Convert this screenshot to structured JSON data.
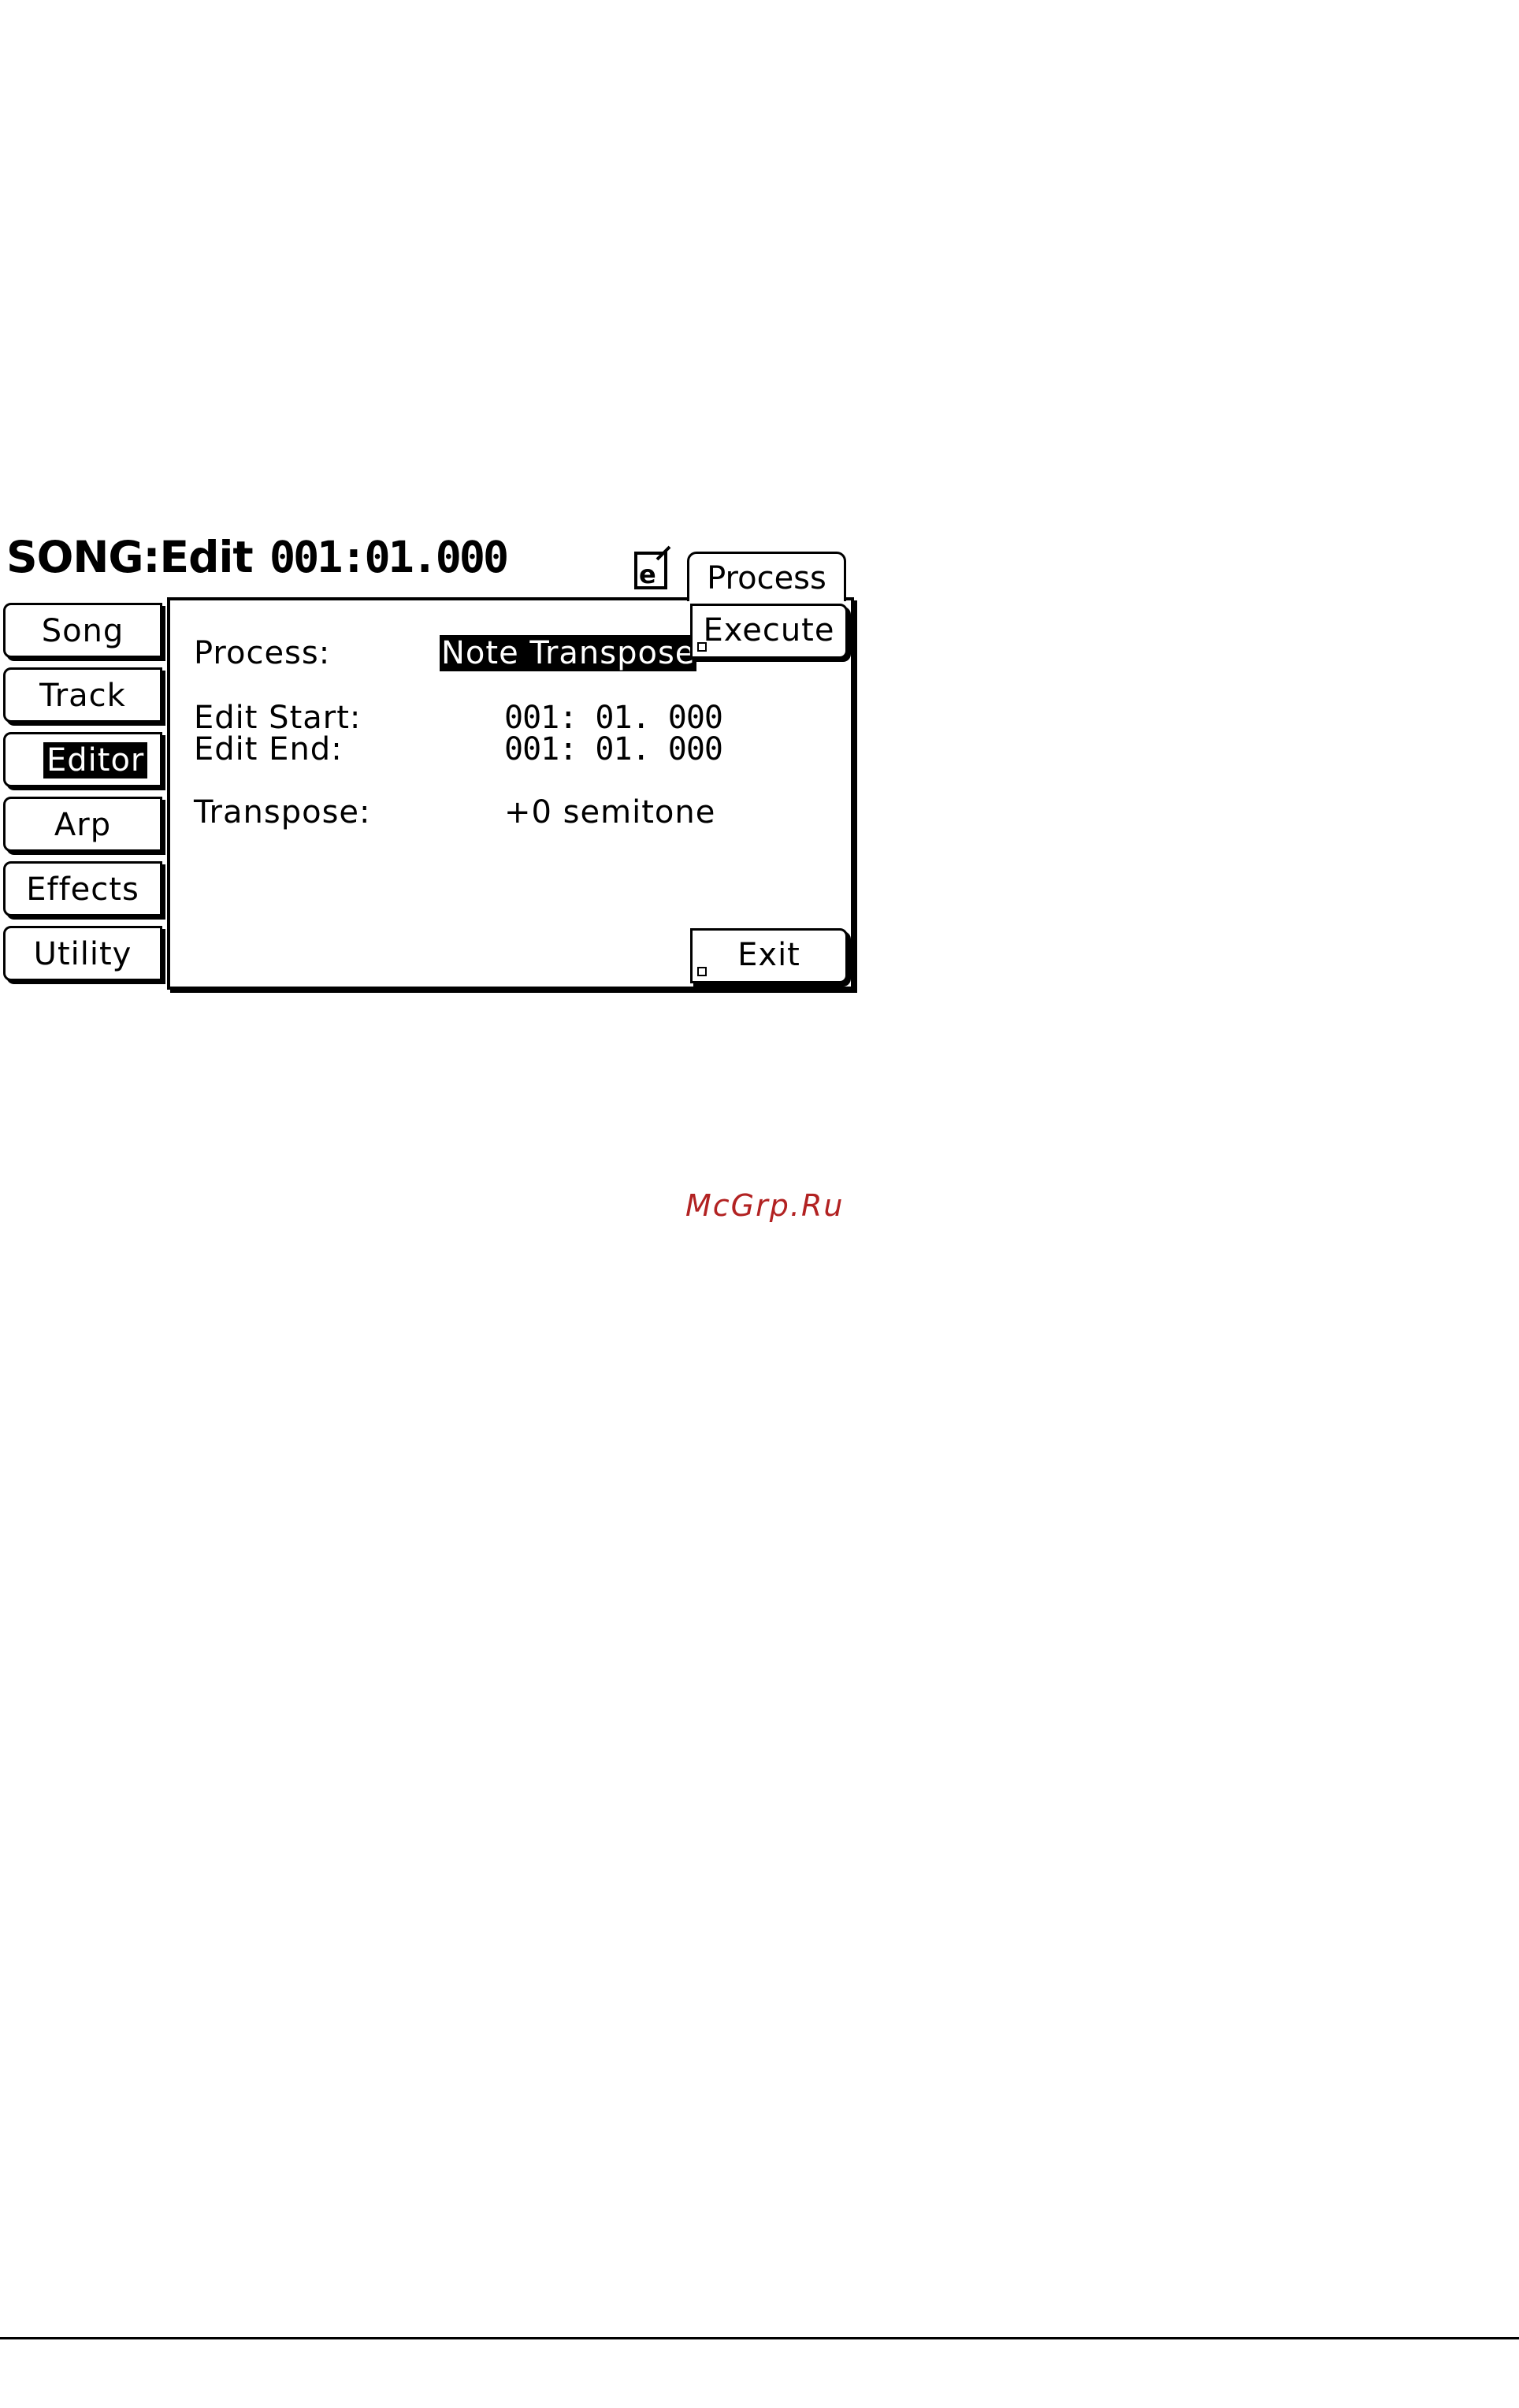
{
  "header": {
    "title": "SONG:Edit",
    "position": "001:01.000",
    "tab": "Process"
  },
  "sidebar": {
    "items": [
      {
        "label": "Song",
        "active": false
      },
      {
        "label": "Track",
        "active": false
      },
      {
        "label": "Editor",
        "active": true
      },
      {
        "label": "Arp",
        "active": false
      },
      {
        "label": "Effects",
        "active": false
      },
      {
        "label": "Utility",
        "active": false
      }
    ]
  },
  "panel": {
    "process_label": "Process:",
    "process_value": "Note Transpose",
    "edit_start_label": "Edit Start:",
    "edit_start_value": "001: 01. 000",
    "edit_end_label": "Edit End:",
    "edit_end_value": "001: 01. 000",
    "transpose_label": "Transpose:",
    "transpose_value": "+0 semitone",
    "execute_label": "Execute",
    "exit_label": "Exit"
  },
  "watermark": "McGrp.Ru",
  "icons": {
    "edit": "edit-icon"
  }
}
